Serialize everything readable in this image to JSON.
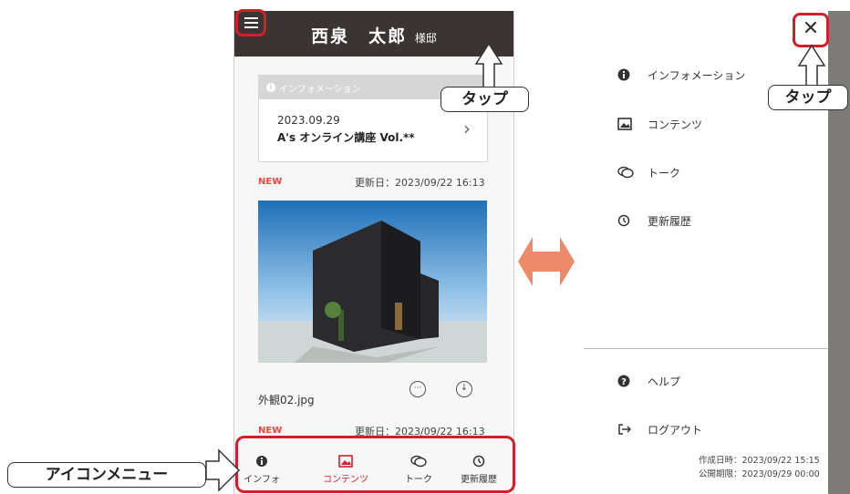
{
  "left": {
    "header": {
      "name": "西泉　太郎",
      "suffix": "様邸"
    },
    "info_card": {
      "label": "インフォメーション",
      "date": "2023.09.29",
      "title": "A's オンライン講座 Vol.**"
    },
    "post1": {
      "badge": "NEW",
      "updated": "更新日：2023/09/22 16:13",
      "filename": "外観02.jpg"
    },
    "post2": {
      "badge": "NEW",
      "updated": "更新日：2023/09/22 16:13"
    },
    "tabs": [
      {
        "label": "インフォ",
        "icon": "info-icon"
      },
      {
        "label": "コンテンツ",
        "icon": "image-icon"
      },
      {
        "label": "トーク",
        "icon": "chat-icon"
      },
      {
        "label": "更新履歴",
        "icon": "history-icon"
      }
    ]
  },
  "callouts": {
    "tap_left": "タップ",
    "tap_right": "タップ",
    "icon_menu": "アイコンメニュー"
  },
  "drawer": {
    "close": "✕",
    "items": [
      {
        "label": "インフォメーション",
        "icon": "info-icon"
      },
      {
        "label": "コンテンツ",
        "icon": "image-icon"
      },
      {
        "label": "トーク",
        "icon": "chat-icon"
      },
      {
        "label": "更新履歴",
        "icon": "history-icon"
      }
    ],
    "bottom": [
      {
        "label": "ヘルプ",
        "icon": "help-icon"
      },
      {
        "label": "ログアウト",
        "icon": "logout-icon"
      }
    ],
    "created": "作成日時：2023/09/22 15:15",
    "expires": "公開期限：2023/09/29 00:00"
  },
  "colors": {
    "accent": "#d0202a",
    "header": "#3a3533",
    "arrow": "#ec8a6a"
  }
}
